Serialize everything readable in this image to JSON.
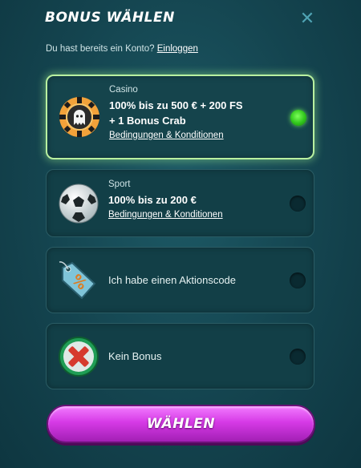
{
  "header": {
    "title": "BONUS WÄHLEN",
    "close_icon": "close-icon"
  },
  "account": {
    "prompt": "Du hast bereits ein Konto?",
    "login_link": "Einloggen"
  },
  "options": [
    {
      "icon": "casino-chip-icon",
      "category": "Casino",
      "offer_line1": "100% bis zu 500 € + 200 FS",
      "offer_line2": "+ 1 Bonus Crab",
      "terms": "Bedingungen & Konditionen",
      "selected": true
    },
    {
      "icon": "soccer-ball-icon",
      "category": "Sport",
      "offer_line1": "100% bis zu 200 €",
      "terms": "Bedingungen & Konditionen",
      "selected": false
    },
    {
      "icon": "promo-tag-icon",
      "label": "Ich habe einen Aktionscode",
      "selected": false
    },
    {
      "icon": "no-bonus-icon",
      "label": "Kein Bonus",
      "selected": false
    }
  ],
  "cta": {
    "label": "WÄHLEN"
  },
  "colors": {
    "selected_glow": "#b9f0a0",
    "radio_on": "#2fc61b",
    "cta": "#d63ae6"
  }
}
